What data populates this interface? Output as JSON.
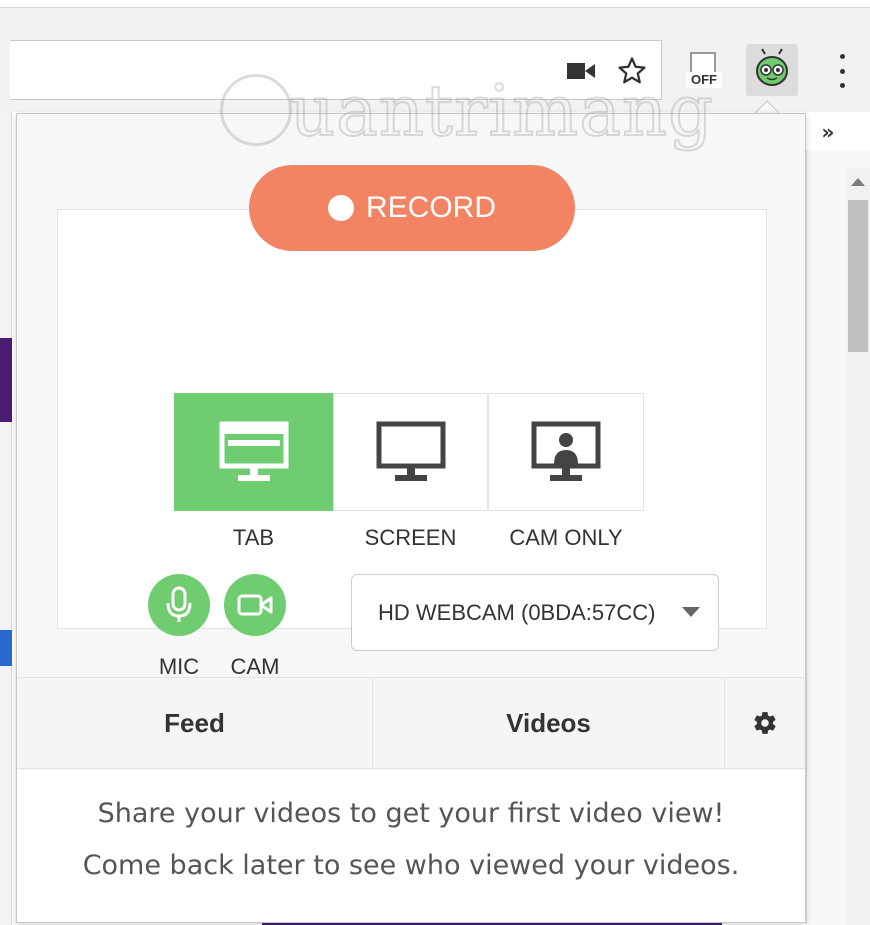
{
  "browser": {
    "ext_off_label": "OFF",
    "bookmark_overflow": "»"
  },
  "popup": {
    "record_label": "RECORD",
    "modes": [
      {
        "label": "TAB",
        "active": true
      },
      {
        "label": "SCREEN",
        "active": false
      },
      {
        "label": "CAM ONLY",
        "active": false
      }
    ],
    "mic_label": "MIC",
    "cam_label": "CAM",
    "camera_select": {
      "value": "HD WEBCAM (0BDA:57CC)"
    },
    "tabs": [
      {
        "label": "Feed"
      },
      {
        "label": "Videos"
      }
    ],
    "feed_message": [
      "Share your videos to get your first video view!",
      "Come back later to see who viewed your videos."
    ]
  },
  "watermark": {
    "text": "uantrimang"
  },
  "colors": {
    "record": "#f38463",
    "accent_green": "#6fcc70",
    "page_purple": "#4a1d72"
  },
  "icons": [
    "video-camera-icon",
    "star-icon",
    "off-extension-icon",
    "loom-extension-icon",
    "menu-icon",
    "settings-icon",
    "microphone-icon",
    "camera-icon",
    "monitor-icon"
  ]
}
